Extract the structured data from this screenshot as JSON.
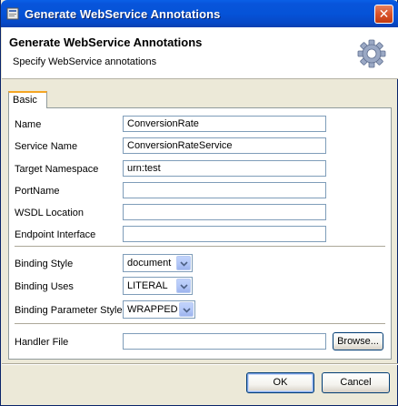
{
  "window": {
    "title": "Generate WebService Annotations"
  },
  "header": {
    "title": "Generate WebService Annotations",
    "description": "Specify WebService annotations",
    "icon": "gear-icon"
  },
  "tabs": [
    {
      "label": "Basic",
      "selected": true
    }
  ],
  "form": {
    "name_label": "Name",
    "name_value": "ConversionRate",
    "service_name_label": "Service Name",
    "service_name_value": "ConversionRateService",
    "target_namespace_label": "Target Namespace",
    "target_namespace_value": "urn:test",
    "port_name_label": "PortName",
    "port_name_value": "",
    "wsdl_location_label": "WSDL Location",
    "wsdl_location_value": "",
    "endpoint_interface_label": "Endpoint Interface",
    "endpoint_interface_value": "",
    "binding_style_label": "Binding Style",
    "binding_style_value": "document",
    "binding_uses_label": "Binding Uses",
    "binding_uses_value": "LITERAL",
    "binding_param_style_label": "Binding Parameter Style",
    "binding_param_style_value": "WRAPPED",
    "handler_file_label": "Handler File",
    "handler_file_value": "",
    "browse_label": "Browse..."
  },
  "buttons": {
    "ok_label": "OK",
    "cancel_label": "Cancel"
  },
  "colors": {
    "titlebar": "#0553D8",
    "dialog_bg": "#ECE9D8",
    "tab_accent": "#F5A623"
  }
}
